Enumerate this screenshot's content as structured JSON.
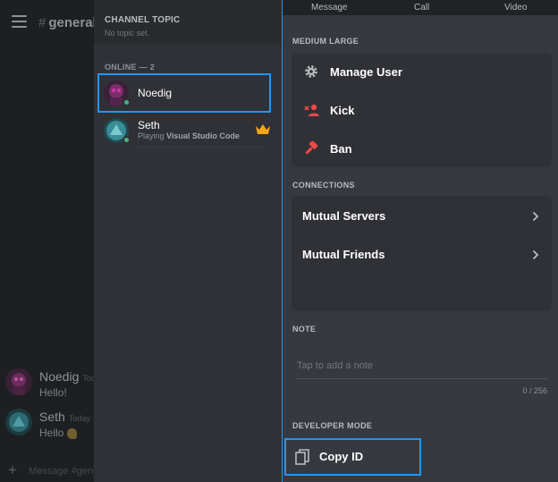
{
  "chat": {
    "channel_hash": "#",
    "channel_name": "general",
    "messages": [
      {
        "author": "Noedig",
        "timestamp": "Tod",
        "text": "Hello!"
      },
      {
        "author": "Seth",
        "timestamp": "Today",
        "text": "Hello",
        "emoji": "waving-hand"
      }
    ],
    "composer_placeholder": "Message #general"
  },
  "members_panel": {
    "topic_header": "CHANNEL TOPIC",
    "topic_value": "No topic set.",
    "online_header": "ONLINE — 2",
    "members": [
      {
        "name": "Noedig",
        "status": "online",
        "selected": true
      },
      {
        "name": "Seth",
        "status": "online",
        "activity_prefix": "Playing",
        "activity_name": "Visual Studio Code",
        "owner": true
      }
    ]
  },
  "user_sheet": {
    "top_actions": [
      "Message",
      "Call",
      "Video"
    ],
    "role_header": "MEDIUM LARGE",
    "moderation_items": [
      {
        "label": "Manage User",
        "icon": "gear-icon"
      },
      {
        "label": "Kick",
        "icon": "kick-user-icon"
      },
      {
        "label": "Ban",
        "icon": "ban-hammer-icon"
      }
    ],
    "connections_header": "CONNECTIONS",
    "connections_items": [
      {
        "label": "Mutual Servers"
      },
      {
        "label": "Mutual Friends"
      }
    ],
    "note_header": "NOTE",
    "note_placeholder": "Tap to add a note",
    "note_count": "0 / 256",
    "developer_header": "DEVELOPER MODE",
    "copy_id_label": "Copy ID"
  },
  "colors": {
    "accent_selection": "#2196f3",
    "online": "#43b581",
    "danger": "#f04747",
    "owner_crown": "#faa61a"
  }
}
